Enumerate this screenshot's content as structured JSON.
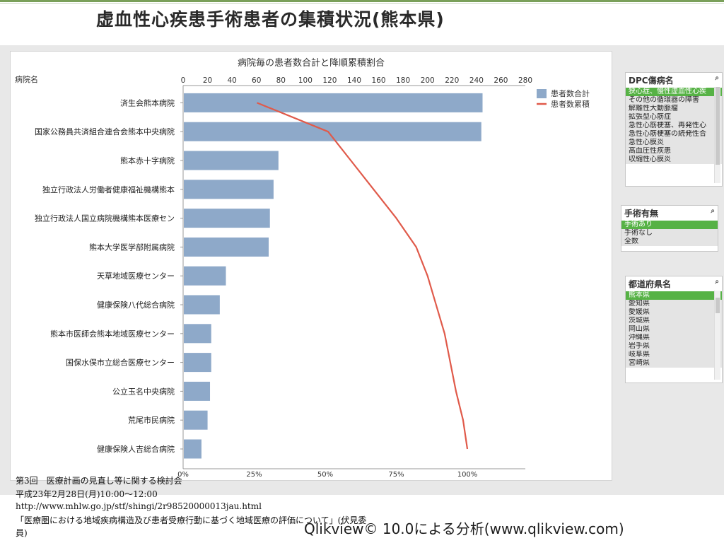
{
  "slide": {
    "title": "虚血性心疾患手術患者の集積状況(熊本県)",
    "qlik_note": "Qlikview© 10.0による分析(www.qlikview.com)"
  },
  "footer_lines": [
    "第3回　医療計画の見直し等に関する検討会",
    "平成23年2月28日(月)10:00～12:00",
    "http://www.mhlw.go.jp/stf/shingi/2r98520000013jau.html",
    "「医療圏における地域疾病構造及び患者受療行動に基づく地域医療の評価について」(伏見委",
    "員)"
  ],
  "colors": {
    "bar": "#8ea9c9",
    "line": "#e05a4a",
    "selected": "#56b245"
  },
  "chart_data": {
    "type": "bar",
    "orientation": "horizontal",
    "title": "病院毎の患者数合計と降順累積割合",
    "category_axis_label": "病院名",
    "categories": [
      "済生会熊本病院",
      "国家公務員共済組合連合会熊本中央病院",
      "熊本赤十字病院",
      "独立行政法人労働者健康福祉機構熊本",
      "独立行政法人国立病院機構熊本医療セン",
      "熊本大学医学部附属病院",
      "天草地域医療センター",
      "健康保険八代総合病院",
      "熊本市医師会熊本地域医療センター",
      "国保水俣市立総合医療センター",
      "公立玉名中央病院",
      "荒尾市民病院",
      "健康保険人吉総合病院"
    ],
    "x_axis_top": {
      "min": 0,
      "max": 280,
      "ticks": [
        0,
        20,
        40,
        60,
        80,
        100,
        120,
        140,
        160,
        180,
        200,
        220,
        240,
        260,
        280
      ]
    },
    "x_axis_bottom": {
      "ticks": [
        "0%",
        "25%",
        "50%",
        "75%",
        "100%"
      ]
    },
    "series": [
      {
        "name": "患者数合計",
        "kind": "bar",
        "values": [
          245,
          244,
          78,
          74,
          71,
          70,
          35,
          30,
          23,
          23,
          22,
          20,
          15
        ]
      },
      {
        "name": "患者数累積",
        "kind": "line",
        "unit": "percent",
        "values": [
          26,
          51,
          59,
          67,
          75,
          82,
          86,
          89,
          92,
          94,
          96,
          98.5,
          100
        ]
      }
    ],
    "legend_position": "top-right"
  },
  "listboxes": [
    {
      "title": "DPC傷病名",
      "items": [
        {
          "label": "狭心症、慢性虚血性心疾",
          "state": "selected"
        },
        {
          "label": "その他の循環器の障害",
          "state": "alt"
        },
        {
          "label": "解離性大動脈瘤",
          "state": "alt"
        },
        {
          "label": "拡張型心筋症",
          "state": "alt"
        },
        {
          "label": "急性心筋梗塞、再発性心",
          "state": "alt"
        },
        {
          "label": "急性心筋梗塞の続発性合",
          "state": "alt"
        },
        {
          "label": "急性心膜炎",
          "state": "alt"
        },
        {
          "label": "高血圧性疾患",
          "state": "alt"
        },
        {
          "label": "収縮性心膜炎",
          "state": "alt"
        }
      ]
    },
    {
      "title": "手術有無",
      "items": [
        {
          "label": "手術あり",
          "state": "selected"
        },
        {
          "label": "手術なし",
          "state": "alt"
        },
        {
          "label": "全数",
          "state": "alt"
        }
      ]
    },
    {
      "title": "都道府県名",
      "items": [
        {
          "label": "熊本県",
          "state": "selected"
        },
        {
          "label": "愛知県",
          "state": "alt"
        },
        {
          "label": "愛媛県",
          "state": "alt"
        },
        {
          "label": "茨城県",
          "state": "alt"
        },
        {
          "label": "岡山県",
          "state": "alt"
        },
        {
          "label": "沖縄県",
          "state": "alt"
        },
        {
          "label": "岩手県",
          "state": "alt"
        },
        {
          "label": "岐阜県",
          "state": "alt"
        },
        {
          "label": "宮崎県",
          "state": "alt"
        }
      ]
    }
  ]
}
